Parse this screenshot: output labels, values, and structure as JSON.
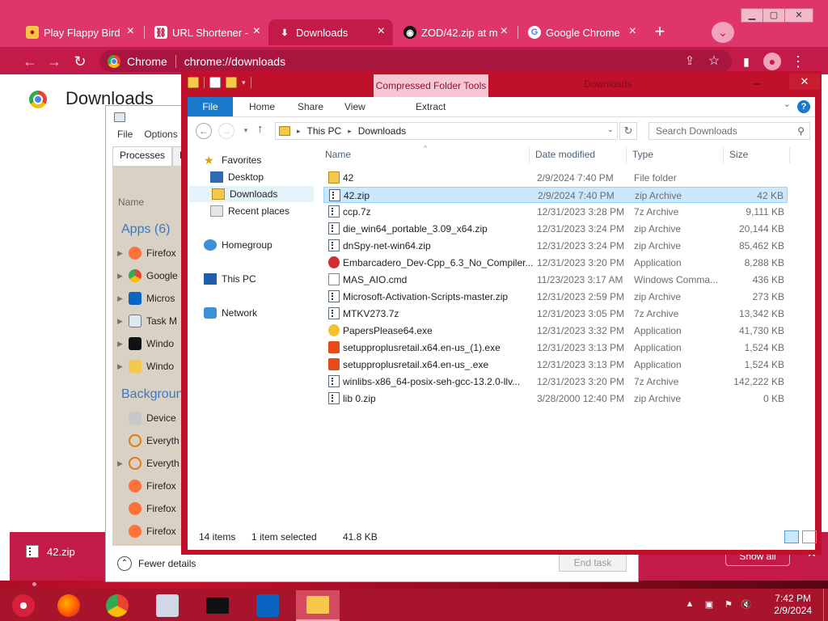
{
  "chrome": {
    "tabs": [
      {
        "title": "Play Flappy Bird",
        "icon": "flappy-bird-icon"
      },
      {
        "title": "URL Shortener -",
        "icon": "link-icon"
      },
      {
        "title": "Downloads",
        "icon": "download-icon",
        "active": true
      },
      {
        "title": "ZOD/42.zip at m",
        "icon": "github-icon"
      },
      {
        "title": "Google Chrome",
        "icon": "google-icon"
      }
    ],
    "omnibox_scheme": "Chrome",
    "omnibox_url": "chrome://downloads",
    "page_title": "Downloads",
    "download_bar": {
      "item": "42.zip",
      "show_all": "Show all"
    },
    "accent": "#e0356b"
  },
  "taskmgr": {
    "menu": [
      "File",
      "Options"
    ],
    "tabs": [
      "Processes",
      "Pe"
    ],
    "name_header": "Name",
    "apps_header": "Apps (6)",
    "apps": [
      {
        "name": "Firefox",
        "icon": "firefox-icon"
      },
      {
        "name": "Google",
        "icon": "chrome-icon"
      },
      {
        "name": "Micros",
        "icon": "outlook-icon"
      },
      {
        "name": "Task M",
        "icon": "task-manager-icon"
      },
      {
        "name": "Windo",
        "icon": "cmd-icon"
      },
      {
        "name": "Windo",
        "icon": "explorer-icon"
      }
    ],
    "background_header": "Backgroun",
    "background": [
      {
        "name": "Device",
        "icon": "device-icon",
        "expandable": false
      },
      {
        "name": "Everyth",
        "icon": "search-icon",
        "expandable": false
      },
      {
        "name": "Everyth",
        "icon": "search-icon",
        "expandable": true
      },
      {
        "name": "Firefox",
        "icon": "firefox-icon",
        "expandable": false
      },
      {
        "name": "Firefox",
        "icon": "firefox-icon",
        "expandable": false
      },
      {
        "name": "Firefox",
        "icon": "firefox-icon",
        "expandable": false
      }
    ],
    "fewer_details": "Fewer details",
    "end_task": "End task"
  },
  "explorer": {
    "title": "Downloads",
    "ctx_tab": "Compressed Folder Tools",
    "ribbon_tabs": [
      "File",
      "Home",
      "Share",
      "View",
      "Extract"
    ],
    "breadcrumb": [
      "This PC",
      "Downloads"
    ],
    "search_placeholder": "Search Downloads",
    "nav": {
      "favorites": "Favorites",
      "desktop": "Desktop",
      "downloads": "Downloads",
      "recent": "Recent places",
      "homegroup": "Homegroup",
      "thispc": "This PC",
      "network": "Network"
    },
    "columns": {
      "name": "Name",
      "date": "Date modified",
      "type": "Type",
      "size": "Size"
    },
    "files": [
      {
        "name": "42",
        "date": "2/9/2024 7:40 PM",
        "type": "File folder",
        "size": "",
        "icon": "folder"
      },
      {
        "name": "42.zip",
        "date": "2/9/2024 7:40 PM",
        "type": "zip Archive",
        "size": "42 KB",
        "icon": "zip",
        "selected": true
      },
      {
        "name": "ccp.7z",
        "date": "12/31/2023 3:28 PM",
        "type": "7z Archive",
        "size": "9,111 KB",
        "icon": "zip"
      },
      {
        "name": "die_win64_portable_3.09_x64.zip",
        "date": "12/31/2023 3:24 PM",
        "type": "zip Archive",
        "size": "20,144 KB",
        "icon": "zip"
      },
      {
        "name": "dnSpy-net-win64.zip",
        "date": "12/31/2023 3:24 PM",
        "type": "zip Archive",
        "size": "85,462 KB",
        "icon": "zip"
      },
      {
        "name": "Embarcadero_Dev-Cpp_6.3_No_Compiler...",
        "date": "12/31/2023 3:20 PM",
        "type": "Application",
        "size": "8,288 KB",
        "icon": "app-red"
      },
      {
        "name": "MAS_AIO.cmd",
        "date": "11/23/2023 3:17 AM",
        "type": "Windows Comma...",
        "size": "436 KB",
        "icon": "cmd"
      },
      {
        "name": "Microsoft-Activation-Scripts-master.zip",
        "date": "12/31/2023 2:59 PM",
        "type": "zip Archive",
        "size": "273 KB",
        "icon": "zip"
      },
      {
        "name": "MTKV273.7z",
        "date": "12/31/2023 3:05 PM",
        "type": "7z Archive",
        "size": "13,342 KB",
        "icon": "zip"
      },
      {
        "name": "PapersPlease64.exe",
        "date": "12/31/2023 3:32 PM",
        "type": "Application",
        "size": "41,730 KB",
        "icon": "paper"
      },
      {
        "name": "setupproplusretail.x64.en-us_(1).exe",
        "date": "12/31/2023 3:13 PM",
        "type": "Application",
        "size": "1,524 KB",
        "icon": "office"
      },
      {
        "name": "setupproplusretail.x64.en-us_.exe",
        "date": "12/31/2023 3:13 PM",
        "type": "Application",
        "size": "1,524 KB",
        "icon": "office"
      },
      {
        "name": "winlibs-x86_64-posix-seh-gcc-13.2.0-llv...",
        "date": "12/31/2023 3:20 PM",
        "type": "7z Archive",
        "size": "142,222 KB",
        "icon": "zip"
      },
      {
        "name": "lib 0.zip",
        "date": "3/28/2000 12:40 PM",
        "type": "zip Archive",
        "size": "0 KB",
        "icon": "zip"
      }
    ],
    "status": {
      "count": "14 items",
      "selection": "1 item selected",
      "size": "41.8 KB"
    }
  },
  "taskbar": {
    "apps": [
      "firefox-icon",
      "chrome-icon",
      "photos-icon",
      "cmd-icon",
      "outlook-icon",
      "explorer-icon"
    ],
    "time": "7:42 PM",
    "date": "2/9/2024"
  }
}
